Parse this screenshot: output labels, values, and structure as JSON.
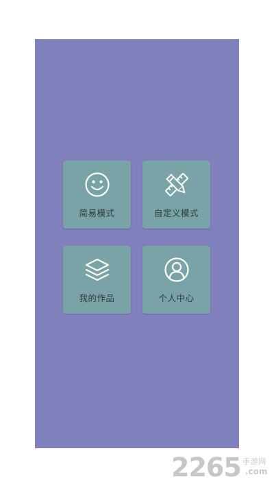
{
  "menu": {
    "items": [
      {
        "label": "简易模式",
        "icon": "smiley-face-icon"
      },
      {
        "label": "自定义模式",
        "icon": "pencil-ruler-icon"
      },
      {
        "label": "我的作品",
        "icon": "layers-icon"
      },
      {
        "label": "个人中心",
        "icon": "user-profile-icon"
      }
    ]
  },
  "watermark": {
    "brand_number": "2265",
    "brand_suffix": ".com",
    "brand_cn": "手游网"
  },
  "colors": {
    "background": "#8080bd",
    "tile": "#7aa3a7",
    "icon_stroke": "#ffffff",
    "label_text": "#2d3c3f"
  }
}
